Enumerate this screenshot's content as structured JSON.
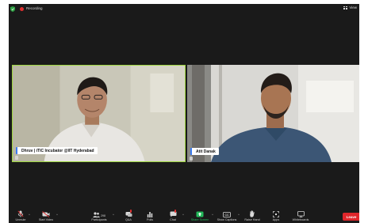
{
  "topbar": {
    "recording_label": "Recording",
    "view_label": "View"
  },
  "participants": [
    {
      "name": "Dhruv | iTIC Incubator @IIT Hyderabad",
      "active_speaker": true
    },
    {
      "name": "Atit Danak",
      "active_speaker": false
    }
  ],
  "toolbar": {
    "unmute": "Unmute",
    "start_video": "Start Video",
    "participants": "Participants",
    "participants_count": "298",
    "qa": "Q&A",
    "polls": "Polls",
    "chat": "Chat",
    "share_screen": "Share Screen",
    "show_captions": "Show Captions",
    "raise_hand": "Raise Hand",
    "apps": "Apps",
    "whiteboards": "Whiteboards",
    "leave": "Leave"
  },
  "colors": {
    "accent_active_speaker": "#9ed63f",
    "recording": "#e02f2f",
    "share_screen": "#23b95a",
    "leave": "#e0262b"
  }
}
